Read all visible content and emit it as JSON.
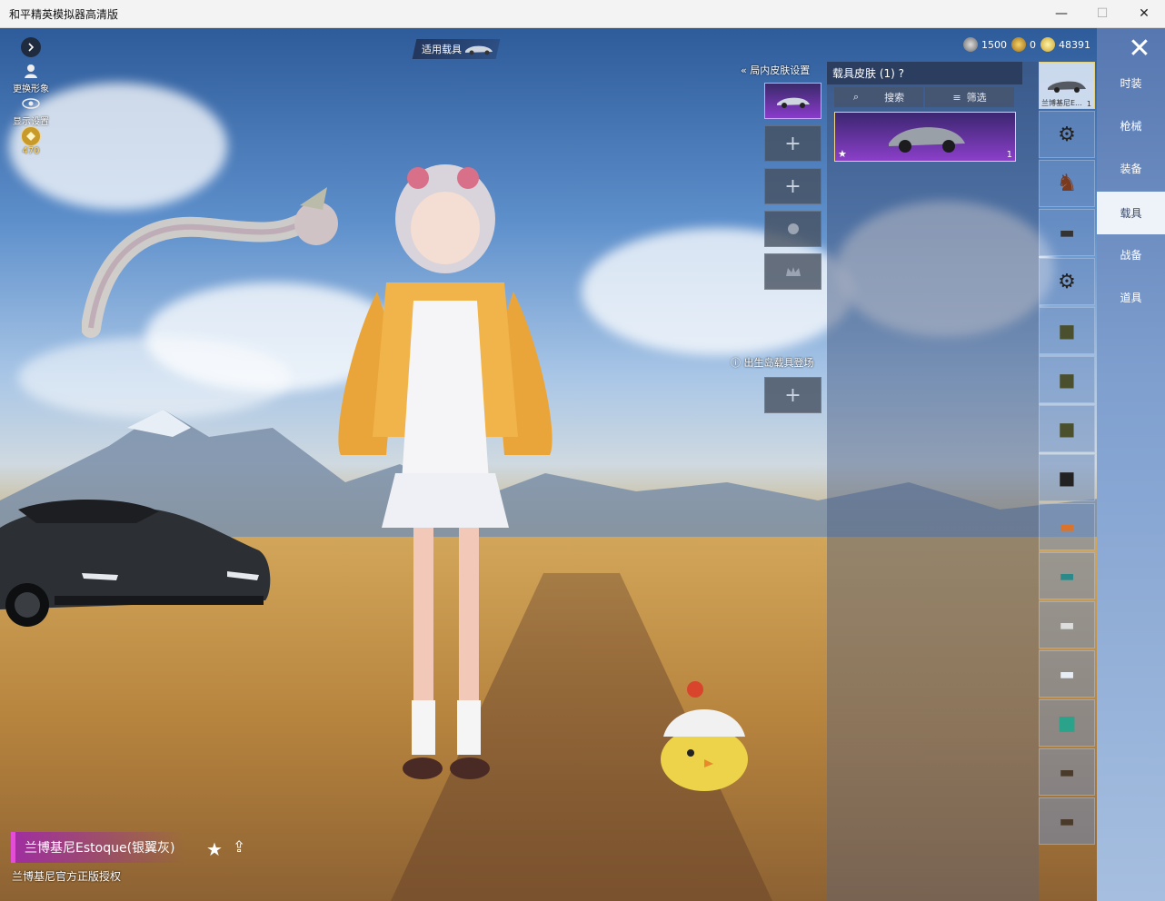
{
  "window": {
    "title": "和平精英模拟器高清版"
  },
  "left_menu": {
    "change_appearance": "更换形象",
    "display_settings": "显示设置",
    "rank_value": "470"
  },
  "applied_vehicle": {
    "label": "适用载具"
  },
  "currency": [
    {
      "icon": "token-icon",
      "value": "1500"
    },
    {
      "icon": "coupon-icon",
      "value": "0"
    },
    {
      "icon": "gold-coin-icon",
      "value": "48391"
    }
  ],
  "in_game_skin": {
    "label": "局内皮肤设置"
  },
  "spawn_vehicle": {
    "label": "出生岛载具登场"
  },
  "vehicle_panel": {
    "title": "载具皮肤",
    "count": "(1)",
    "search_label": "搜索",
    "filter_label": "筛选",
    "card_count": "1"
  },
  "vehicle_list": {
    "selected_name": "兰博基尼E...",
    "selected_count": "1"
  },
  "tabs": [
    "时装",
    "枪械",
    "装备",
    "载具",
    "战备",
    "道具"
  ],
  "active_tab": "载具",
  "caption": {
    "name": "兰博基尼Estoque(银翼灰)",
    "subtitle": "兰博基尼官方正版授权"
  },
  "colors": {
    "accent_purple": "#e24fd6",
    "panel_blue": "#5677b0",
    "active_tab_bg": "#eef3fa"
  }
}
